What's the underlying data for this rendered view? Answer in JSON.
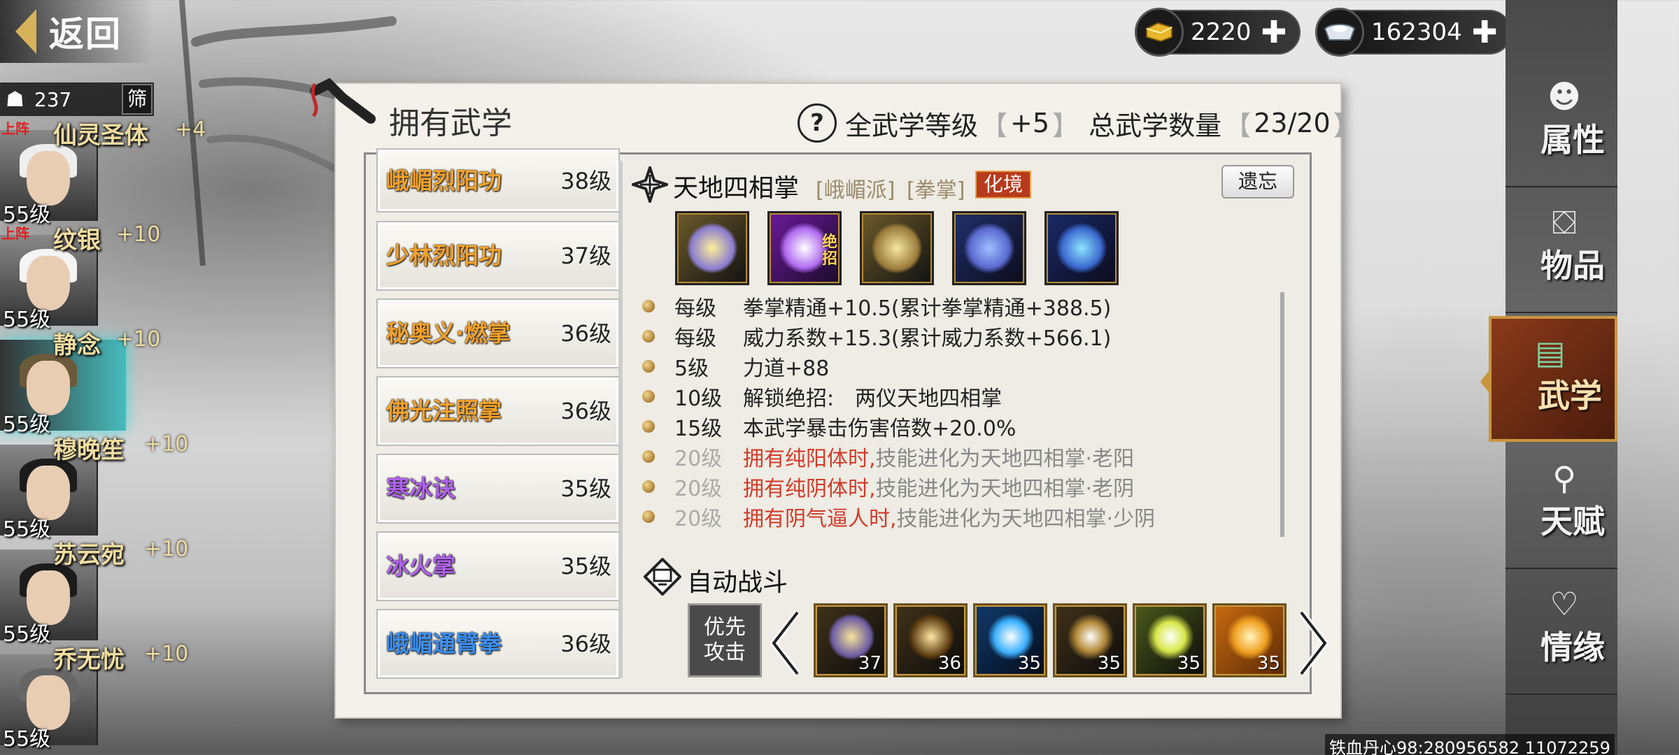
{
  "top": {
    "back_label": "返回",
    "currency_gold": "2220",
    "currency_silver": "162304",
    "gold_icon": "gold-ingot-icon",
    "silver_icon": "silver-ingot-icon"
  },
  "roster": {
    "count": "237",
    "filter_label": "筛",
    "heroes": [
      {
        "name": "仙灵圣体",
        "bonus": "+4",
        "level": "55级",
        "deploy": "上阵"
      },
      {
        "name": "纹银",
        "bonus": "+10",
        "level": "55级",
        "deploy": "上阵"
      },
      {
        "name": "静念",
        "bonus": "+10",
        "level": "55级",
        "deploy": ""
      },
      {
        "name": "穆晚笙",
        "bonus": "+10",
        "level": "55级",
        "deploy": ""
      },
      {
        "name": "苏云宛",
        "bonus": "+10",
        "level": "55级",
        "deploy": ""
      },
      {
        "name": "乔无忧",
        "bonus": "+10",
        "level": "55级",
        "deploy": ""
      }
    ]
  },
  "panel": {
    "title": "拥有武学",
    "all_level_label": "全武学等级",
    "all_level_value": "+5",
    "total_label": "总武学数量",
    "total_value": "23/20",
    "bracket_l": "【",
    "bracket_r": "】",
    "help": "?"
  },
  "skill_list": [
    {
      "name": "峨嵋烈阳功",
      "level": "38级",
      "color": "#f3a12b"
    },
    {
      "name": "少林烈阳功",
      "level": "37级",
      "color": "#f3a12b"
    },
    {
      "name": "秘奥义·燃掌",
      "level": "36级",
      "color": "#f3a12b"
    },
    {
      "name": "佛光注照掌",
      "level": "36级",
      "color": "#f3a12b"
    },
    {
      "name": "寒冰诀",
      "level": "35级",
      "color": "#b061ec"
    },
    {
      "name": "冰火掌",
      "level": "35级",
      "color": "#b061ec"
    },
    {
      "name": "峨嵋通臂拳",
      "level": "36级",
      "color": "#3d8ff0"
    }
  ],
  "detail": {
    "name": "天地四相掌",
    "sect": "[峨嵋派]",
    "type": "[拳掌]",
    "realm": "化境",
    "forget": "遗忘",
    "ultimate_badge": "绝招",
    "effects": [
      {
        "k": "每级",
        "v": "拳掌精通+10.5(累计拳掌精通+388.5)",
        "locked": false,
        "cond": ""
      },
      {
        "k": "每级",
        "v": "威力系数+15.3(累计威力系数+566.1)",
        "locked": false,
        "cond": ""
      },
      {
        "k": "5级",
        "v": "力道+88",
        "locked": false,
        "cond": ""
      },
      {
        "k": "10级",
        "v": "解锁绝招:　两仪天地四相掌",
        "locked": false,
        "cond": ""
      },
      {
        "k": "15级",
        "v": "本武学暴击伤害倍数+20.0%",
        "locked": false,
        "cond": ""
      },
      {
        "k": "20级",
        "v": "技能进化为天地四相掌·老阳",
        "locked": true,
        "cond": "拥有纯阳体时,"
      },
      {
        "k": "20级",
        "v": "技能进化为天地四相掌·老阴",
        "locked": true,
        "cond": "拥有纯阴体时,"
      },
      {
        "k": "20级",
        "v": "技能进化为天地四相掌·少阴",
        "locked": true,
        "cond": "拥有阴气逼人时,"
      }
    ]
  },
  "auto": {
    "label": "自动战斗",
    "priority": [
      "优先",
      "攻击"
    ],
    "slots": [
      "37",
      "36",
      "35",
      "35",
      "35",
      "35"
    ]
  },
  "nav": {
    "tabs": [
      {
        "label": "属性",
        "icon": "character-icon"
      },
      {
        "label": "物品",
        "icon": "gift-box-icon"
      },
      {
        "label": "武学",
        "icon": "book-icon"
      },
      {
        "label": "天赋",
        "icon": "talent-tree-icon"
      },
      {
        "label": "情缘",
        "icon": "heart-icon"
      }
    ]
  },
  "watermark": "铁血丹心98:280956582 11072259",
  "colors": {
    "accent": "#c9963e",
    "active_tab": "#8a3a1a",
    "locked_red": "#d23b2a"
  }
}
